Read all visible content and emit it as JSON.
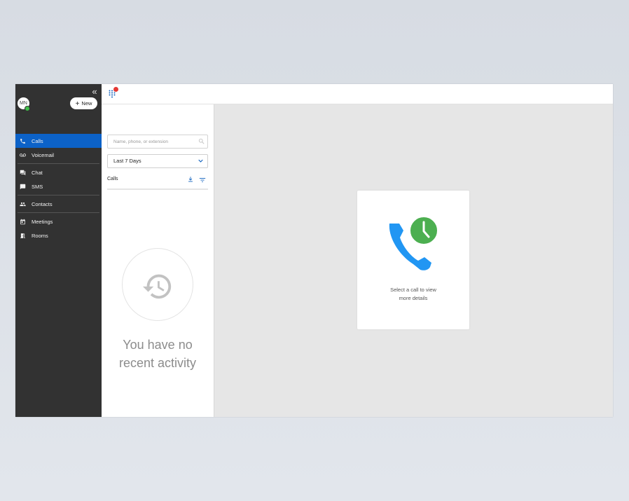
{
  "user": {
    "initials": "MN",
    "status": "online"
  },
  "sidebar": {
    "new_label": "New",
    "items": [
      {
        "label": "Calls",
        "icon": "phone-icon",
        "active": true
      },
      {
        "label": "Voicemail",
        "icon": "voicemail-icon"
      },
      {
        "label": "Chat",
        "icon": "chat-icon"
      },
      {
        "label": "SMS",
        "icon": "sms-icon"
      },
      {
        "label": "Contacts",
        "icon": "contacts-icon"
      },
      {
        "label": "Meetings",
        "icon": "calendar-icon"
      },
      {
        "label": "Rooms",
        "icon": "rooms-icon"
      }
    ]
  },
  "topbar": {
    "icon": "dialpad-icon",
    "notification": true
  },
  "calls_panel": {
    "search_placeholder": "Name, phone, or extension",
    "date_range": "Last 7 Days",
    "title": "Calls",
    "empty_line1": "You have no",
    "empty_line2": "recent activity"
  },
  "detail": {
    "line1": "Select a call to view",
    "line2": "more details"
  },
  "colors": {
    "sidebar_bg": "#323232",
    "active_item": "#0c62c8",
    "phone_blue": "#2196f3",
    "clock_green": "#4caf50",
    "notification_red": "#e53935"
  }
}
